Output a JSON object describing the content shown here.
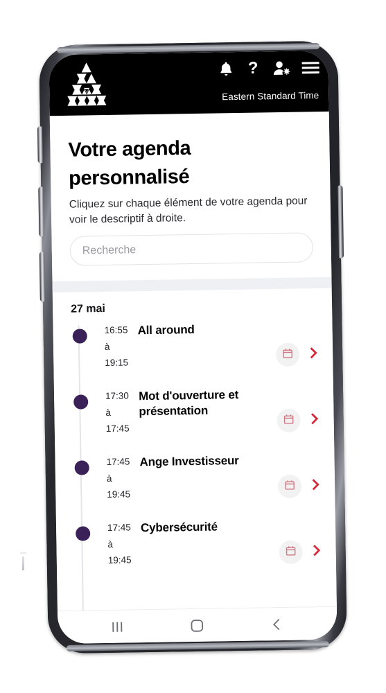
{
  "header": {
    "logo_name": "sierpinski-triangle-logo",
    "timezone": "Eastern Standard Time",
    "icons": [
      {
        "name": "bell-icon",
        "label": "Notifications"
      },
      {
        "name": "help-question-icon",
        "label": "Aide"
      },
      {
        "name": "user-settings-icon",
        "label": "Profil"
      },
      {
        "name": "hamburger-menu-icon",
        "label": "Menu"
      }
    ]
  },
  "page": {
    "title": "Votre agenda personnalisé",
    "subtitle": "Cliquez sur chaque élément de votre agenda pour voir le descriptif à droite."
  },
  "search": {
    "value": "",
    "placeholder": "Recherche"
  },
  "agenda": {
    "day_label": "27 mai",
    "items": [
      {
        "start": "16:55",
        "separator": "à",
        "end": "19:15",
        "title": "All around",
        "calendar_action": "Ajouter au calendrier",
        "detail_action": "Voir le détail"
      },
      {
        "start": "17:30",
        "separator": "à",
        "end": "17:45",
        "title": "Mot d'ouverture et présentation",
        "calendar_action": "Ajouter au calendrier",
        "detail_action": "Voir le détail"
      },
      {
        "start": "17:45",
        "separator": "à",
        "end": "19:45",
        "title": "Ange Investisseur",
        "calendar_action": "Ajouter au calendrier",
        "detail_action": "Voir le détail"
      },
      {
        "start": "17:45",
        "separator": "à",
        "end": "19:45",
        "title": "Cybersécurité",
        "calendar_action": "Ajouter au calendrier",
        "detail_action": "Voir le détail"
      }
    ]
  },
  "navbar": {
    "recents_label": "Recents",
    "home_label": "Home",
    "back_label": "Back"
  },
  "colors": {
    "appbar_background": "#000000",
    "timeline_dot": "#3a2157",
    "timeline_line": "#e6e4ea",
    "chevron_red": "#d32a3c",
    "calendar_icon": "#cf7683",
    "calendar_circle": "#f2f2f3",
    "divider_band": "#eef0f3",
    "page_background": "#ffffff"
  }
}
